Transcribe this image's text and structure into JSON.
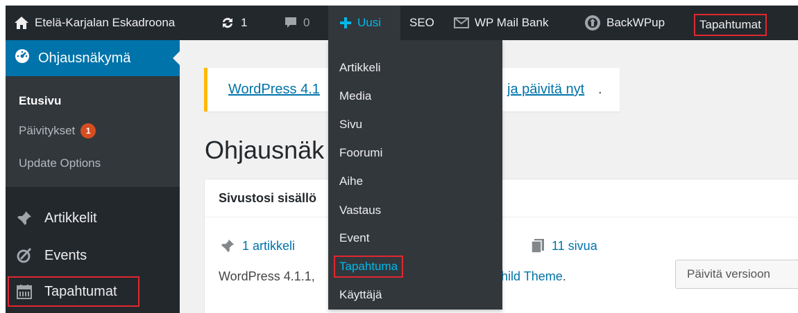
{
  "adminbar": {
    "site_name": "Etelä-Karjalan Eskadroona",
    "updates_count": "1",
    "comments_count": "0",
    "new_label": "Uusi",
    "seo_label": "SEO",
    "mailbank_label": "WP Mail Bank",
    "backwpup_label": "BackWPup",
    "tapahtumat_label": "Tapahtumat"
  },
  "new_menu": {
    "items": [
      "Artikkeli",
      "Media",
      "Sivu",
      "Foorumi",
      "Aihe",
      "Vastaus",
      "Event",
      "Tapahtuma",
      "Käyttäjä"
    ],
    "active_item": "Tapahtuma"
  },
  "sidebar": {
    "dashboard_label": "Ohjausnäkymä",
    "submenu": {
      "home_label": "Etusivu",
      "updates_label": "Päivitykset",
      "updates_badge": "1",
      "update_options_label": "Update Options"
    },
    "items": [
      {
        "label": "Artikkelit",
        "icon": "pin-icon"
      },
      {
        "label": "Events",
        "icon": "events-icon"
      },
      {
        "label": "Tapahtumat",
        "icon": "calendar-icon"
      }
    ]
  },
  "main": {
    "notice_link_1": "WordPress 4.1",
    "notice_link_2": "ja päivitä nyt",
    "notice_tail": ".",
    "page_title": "Ohjausnäk",
    "box_title": "Sivustosi sisällö",
    "articles_label": "1 artikkeli",
    "pages_label": "11 sivua",
    "version_text": "WordPress 4.1.1,",
    "theme_link": "Child Theme",
    "theme_tail": ".",
    "update_button": "Päivitä versioon"
  },
  "colors": {
    "adminbar_bg": "#23282d",
    "highlight": "#0073aa",
    "active_blue": "#00b9eb",
    "annotation_red": "#e0282e",
    "notice_border": "#ffba00"
  }
}
